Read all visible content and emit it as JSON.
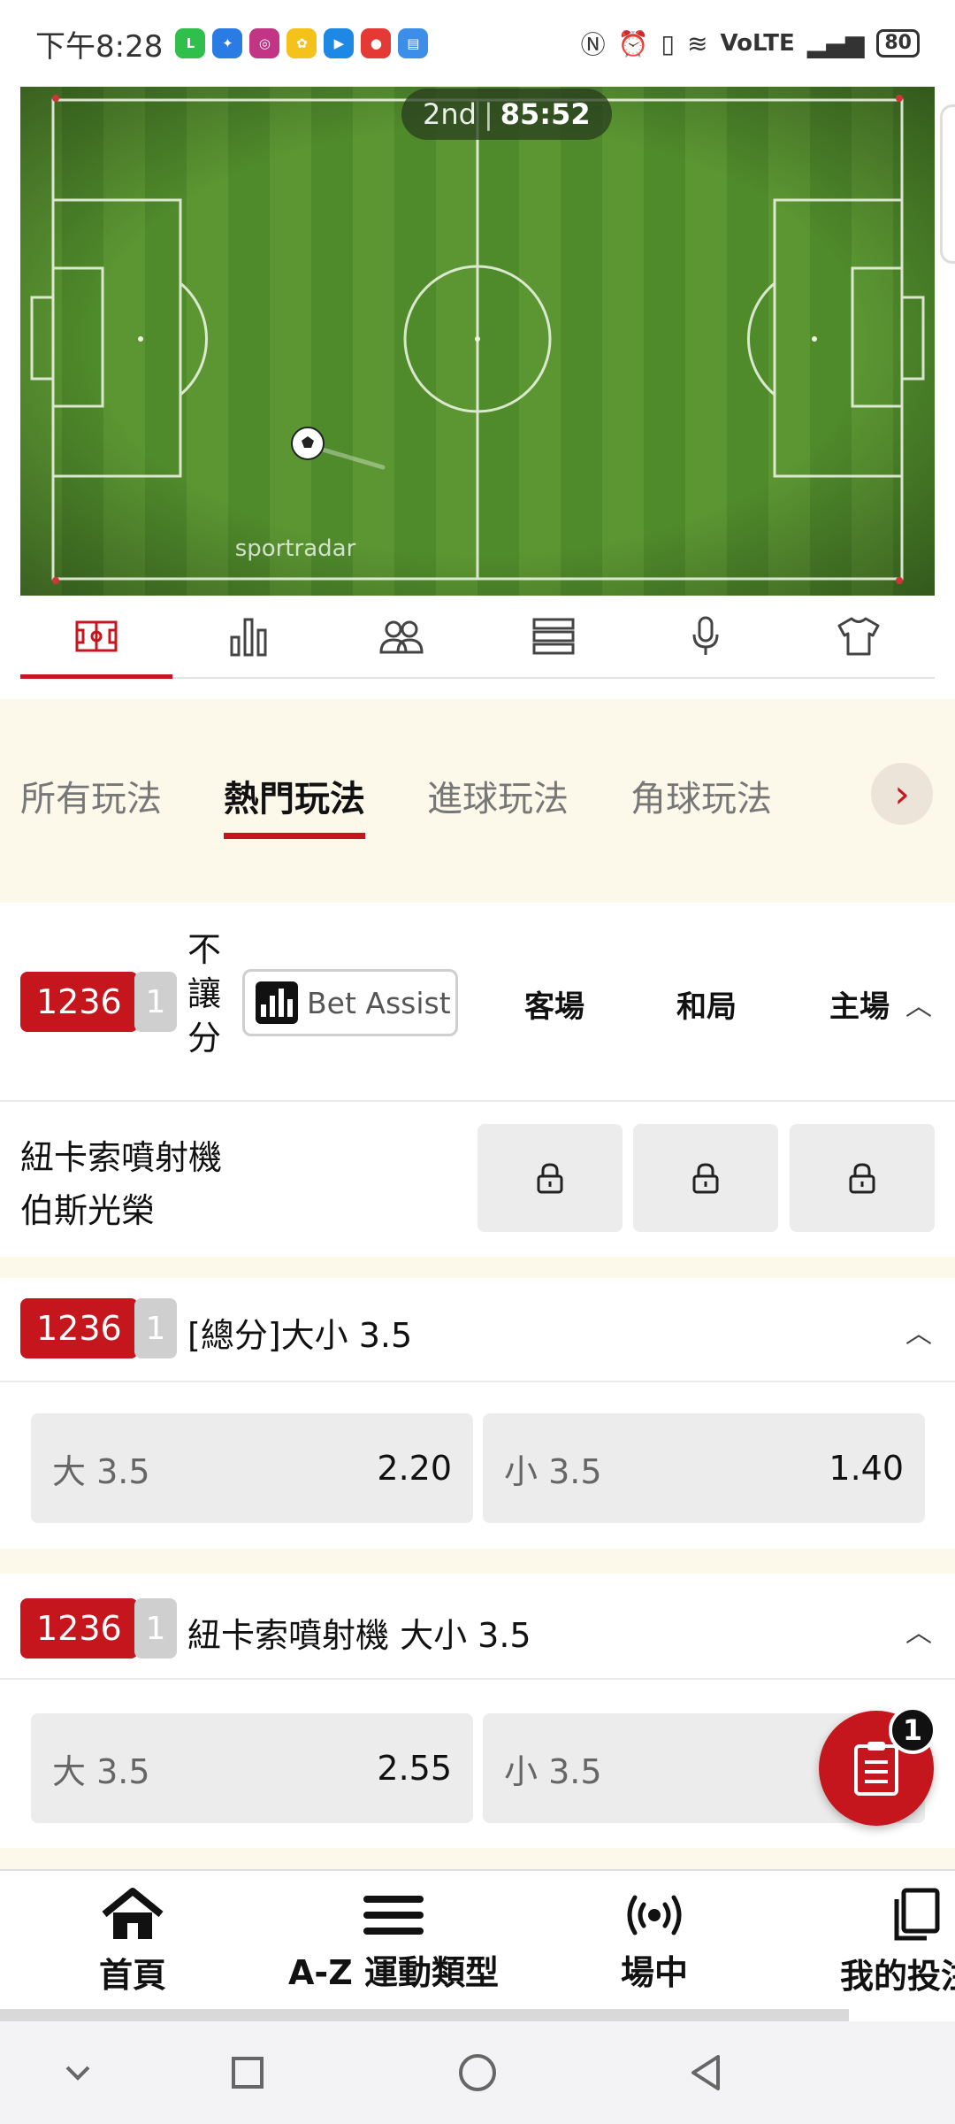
{
  "status_bar": {
    "time": "下午8:28",
    "apps": [
      "LINE",
      "app",
      "ig",
      "app",
      "yt",
      "app",
      "app"
    ],
    "network": "VoLTE",
    "battery": "80"
  },
  "pitch": {
    "period": "2nd",
    "clock": "85:52",
    "provider_logo": "sportradar"
  },
  "icon_tabs": [
    "pitch-icon",
    "stats-icon",
    "lineup-icon",
    "list-icon",
    "microphone-icon",
    "jersey-icon"
  ],
  "market_tabs": [
    "所有玩法",
    "熱門玩法",
    "進球玩法",
    "角球玩法"
  ],
  "active_market_tab": "熱門玩法",
  "markets": {
    "m1": {
      "id": "1236",
      "count": "1",
      "title_lines": [
        "不",
        "讓",
        "分"
      ],
      "bet_assist": "Bet Assist",
      "columns": [
        "客場",
        "和局",
        "主場"
      ],
      "team_lines": [
        "紐卡索噴射機",
        "伯斯光榮"
      ]
    },
    "m2": {
      "id": "1236",
      "count": "1",
      "title": "[總分]大小 3.5",
      "over_label": "大 3.5",
      "over_odds": "2.20",
      "under_label": "小 3.5",
      "under_odds": "1.40"
    },
    "m3": {
      "id": "1236",
      "count": "1",
      "title": "紐卡索噴射機 大小 3.5",
      "over_label": "大 3.5",
      "over_odds": "2.55",
      "under_label": "小 3.5"
    }
  },
  "betslip_count": "1",
  "bottom_nav": {
    "home": "首頁",
    "sports": "A-Z 運動類型",
    "live": "場中",
    "mybets": "我的投注"
  },
  "colors": {
    "accent": "#c4161c",
    "band": "#fdf9ea",
    "pitch_green": "#4f8a2b"
  }
}
